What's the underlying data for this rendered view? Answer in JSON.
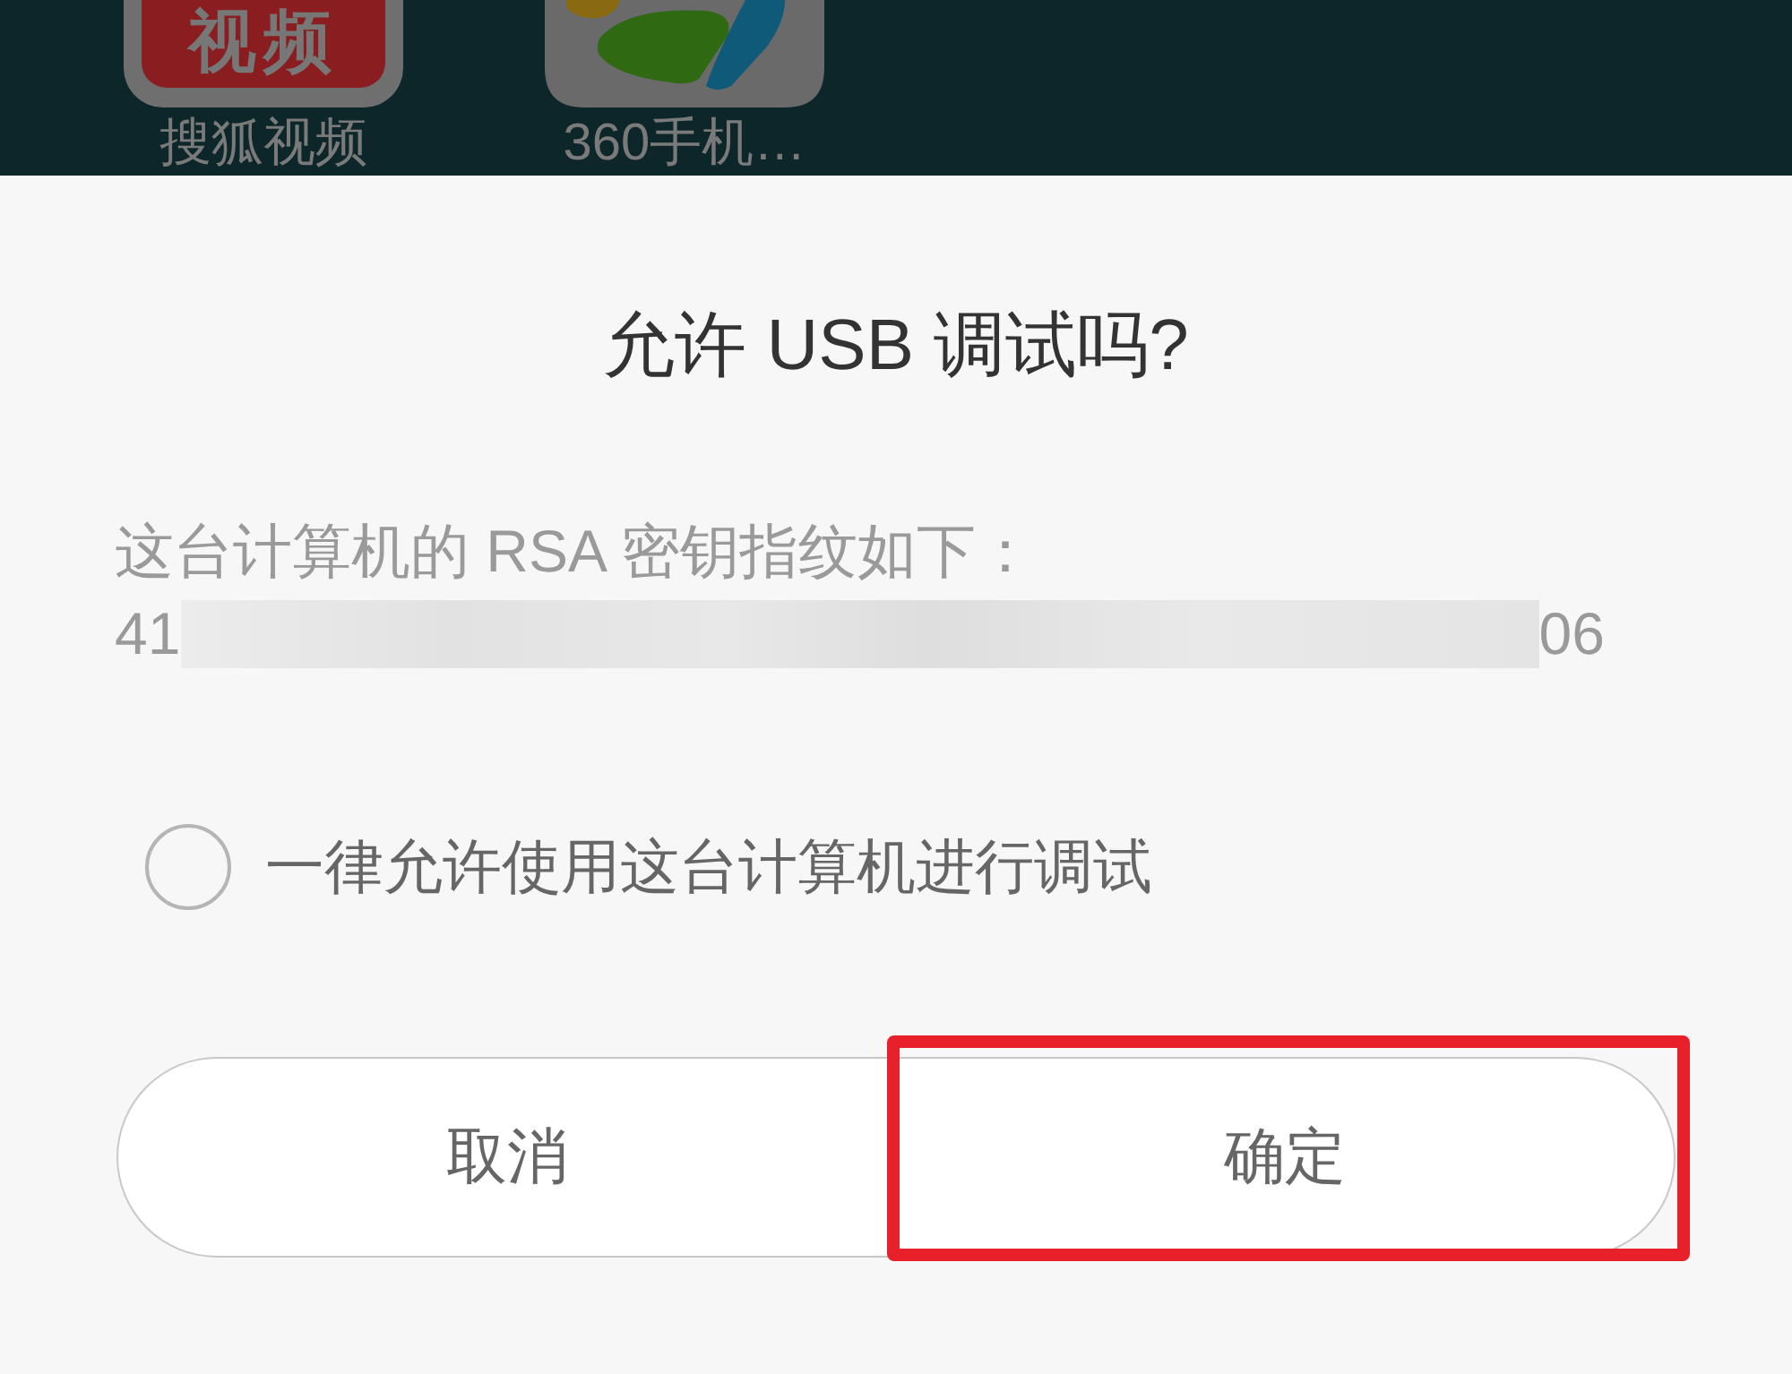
{
  "home_screen": {
    "apps": [
      {
        "kind": "text_tile",
        "icon_text": "视频",
        "label": "搜狐视频"
      },
      {
        "kind": "petals",
        "label": "360手机…"
      }
    ]
  },
  "dialog": {
    "title": "允许 USB 调试吗?",
    "message": "这台计算机的 RSA 密钥指纹如下：",
    "fingerprint": {
      "start": "41",
      "redacted": true,
      "end": "06"
    },
    "remember": {
      "label": "一律允许使用这台计算机进行调试",
      "checked": false
    },
    "buttons": [
      {
        "label": "取消",
        "highlighted": false
      },
      {
        "label": "确定",
        "highlighted": true
      }
    ]
  }
}
